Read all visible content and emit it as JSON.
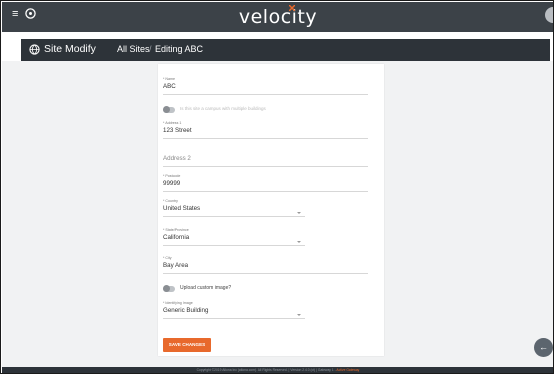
{
  "topbar": {
    "logo": "velocity",
    "menu_icon": "hamburger-icon",
    "globe_icon": "globe-icon"
  },
  "header": {
    "title": "Site Modify",
    "breadcrumb": [
      "All Sites",
      "Editing ABC"
    ],
    "separator": "/"
  },
  "form": {
    "name": {
      "label": "* Name",
      "value": "ABC"
    },
    "campus_toggle_label": "Is this site a campus with multiple buildings",
    "address1": {
      "label": "* Address 1",
      "value": "123 Street"
    },
    "address2": {
      "placeholder": "Address 2"
    },
    "postcode": {
      "label": "* Postcode",
      "value": "99999"
    },
    "country": {
      "label": "* Country",
      "value": "United States"
    },
    "state": {
      "label": "* State/Province",
      "value": "California"
    },
    "city": {
      "label": "* City",
      "value": "Bay Area"
    },
    "upload_toggle_label": "Upload custom image?",
    "image": {
      "label": "* Identifying Image",
      "value": "Generic Building"
    },
    "save_label": "SAVE CHANGES"
  },
  "footer": {
    "text": "Copyright ©2019 Atlona Inc (atlona.com). All Rights Reserved. | Version 2.4.0 (ct) | Gateway 1 -",
    "active": "Active Gateway"
  },
  "colors": {
    "accent": "#e8692c",
    "topbar": "#3c4248",
    "header": "#2d3339"
  }
}
